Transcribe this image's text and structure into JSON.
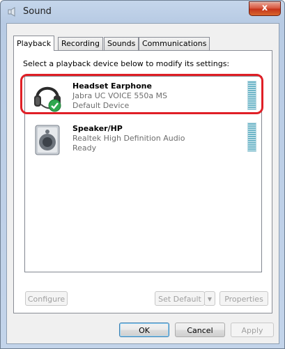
{
  "window": {
    "title": "Sound",
    "close_glyph": "x"
  },
  "tabs": [
    {
      "label": "Playback",
      "active": true
    },
    {
      "label": "Recording",
      "active": false
    },
    {
      "label": "Sounds",
      "active": false
    },
    {
      "label": "Communications",
      "active": false
    }
  ],
  "panel": {
    "instruction": "Select a playback device below to modify its settings:"
  },
  "devices": [
    {
      "name": "Headset Earphone",
      "model": "Jabra UC VOICE 550a MS",
      "status": "Default Device",
      "icon": "headset-icon",
      "badge": "default-check-icon",
      "selected": true
    },
    {
      "name": "Speaker/HP",
      "model": "Realtek High Definition Audio",
      "status": "Ready",
      "icon": "speaker-icon",
      "selected": false
    }
  ],
  "panel_buttons": {
    "configure": "Configure",
    "set_default": "Set Default",
    "set_default_arrow": "▼",
    "properties": "Properties"
  },
  "dialog_buttons": {
    "ok": "OK",
    "cancel": "Cancel",
    "apply": "Apply"
  },
  "colors": {
    "selection_ring": "#e01f26",
    "close_button": "#c4331a",
    "check_badge": "#2fa84f",
    "level_meter": "#6fb6c8"
  }
}
